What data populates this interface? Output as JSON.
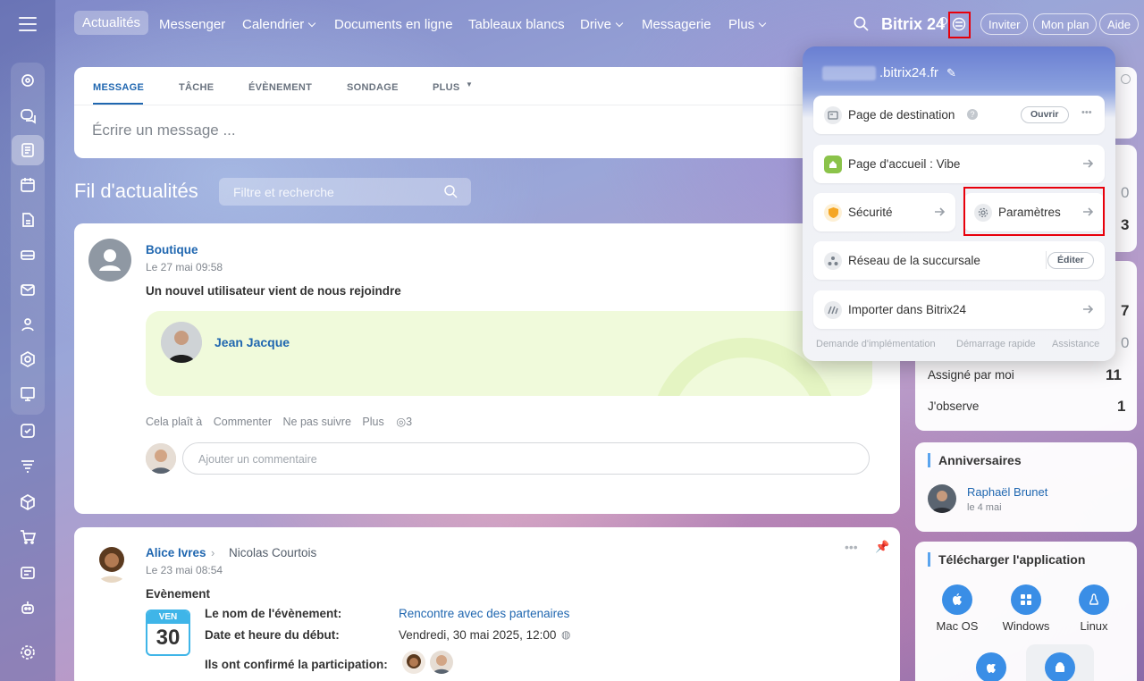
{
  "nav": {
    "items": [
      "Actualités",
      "Messenger",
      "Calendrier",
      "Documents en ligne",
      "Tableaux blancs",
      "Drive",
      "Messagerie",
      "Plus"
    ],
    "brand": "Bitrix 24",
    "invite": "Inviter",
    "plan": "Mon plan",
    "help": "Aide"
  },
  "composer": {
    "tabs": [
      "MESSAGE",
      "TÂCHE",
      "ÉVÈNEMENT",
      "SONDAGE",
      "PLUS"
    ],
    "placeholder": "Écrire un message ..."
  },
  "feed": {
    "title": "Fil d'actualités",
    "filter_placeholder": "Filtre et recherche"
  },
  "post1": {
    "author": "Boutique",
    "date": "Le 27 mai 09:58",
    "text": "Un nouvel utilisateur vient de nous rejoindre",
    "new_user": "Jean Jacque",
    "actions": [
      "Cela plaît à",
      "Commenter",
      "Ne pas suivre",
      "Plus"
    ],
    "views": "3",
    "comment_placeholder": "Ajouter un commentaire"
  },
  "post2": {
    "author": "Alice Ivres",
    "recipient": "Nicolas Courtois",
    "date": "Le 23 mai 08:54",
    "type": "Evènement",
    "cal_day": "VEN",
    "cal_num": "30",
    "field1_label": "Le nom de l'évènement:",
    "field1_value": "Rencontre avec des partenaires",
    "field2_label": "Date et heure du début:",
    "field2_value": "Vendredi, 30 mai 2025, 12:00",
    "field3_label": "Ils ont confirmé la participation:"
  },
  "popup": {
    "domain": ".bitrix24.fr",
    "landing": "Page de destination",
    "open": "Ouvrir",
    "home": "Page d'accueil : Vibe",
    "security": "Sécurité",
    "settings": "Paramètres",
    "branch": "Réseau de la succursale",
    "edit": "Éditer",
    "import": "Importer dans Bitrix24",
    "footer": [
      "Demande d'implémentation",
      "Démarrage rapide",
      "Assistance"
    ]
  },
  "tasks": {
    "partial_nums": [
      "0",
      "3",
      "7",
      "0"
    ],
    "rows": [
      {
        "label": "Assigné par moi",
        "count": "11"
      },
      {
        "label": "J'observe",
        "count": "1"
      }
    ]
  },
  "birthdays": {
    "title": "Anniversaires",
    "name": "Raphaël Brunet",
    "date": "le 4 mai"
  },
  "apps": {
    "title": "Télécharger l'application",
    "items": [
      "Mac OS",
      "Windows",
      "Linux"
    ]
  },
  "colors": {
    "accent": "#2067b0",
    "highlight": "#e8000b",
    "rail_active": "#ffffff"
  }
}
